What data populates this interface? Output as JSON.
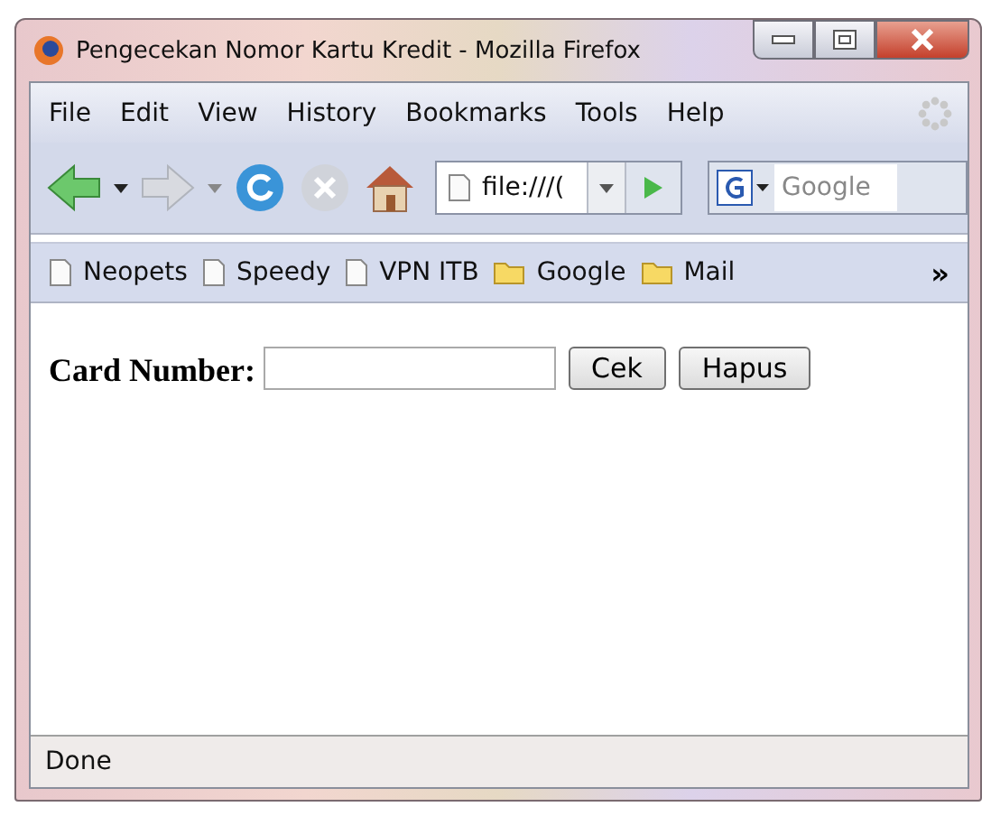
{
  "window": {
    "title": "Pengecekan Nomor Kartu Kredit - Mozilla Firefox"
  },
  "menu": [
    "File",
    "Edit",
    "View",
    "History",
    "Bookmarks",
    "Tools",
    "Help"
  ],
  "address": {
    "value": "file:///("
  },
  "search": {
    "placeholder": "Google"
  },
  "bookmarks": [
    {
      "label": "Neopets",
      "kind": "page"
    },
    {
      "label": "Speedy",
      "kind": "page"
    },
    {
      "label": "VPN ITB",
      "kind": "page"
    },
    {
      "label": "Google",
      "kind": "folder"
    },
    {
      "label": "Mail",
      "kind": "folder"
    }
  ],
  "bookmarks_overflow": "»",
  "form": {
    "label": "Card Number:",
    "buttons": [
      "Cek",
      "Hapus"
    ]
  },
  "status_bar": "Done"
}
